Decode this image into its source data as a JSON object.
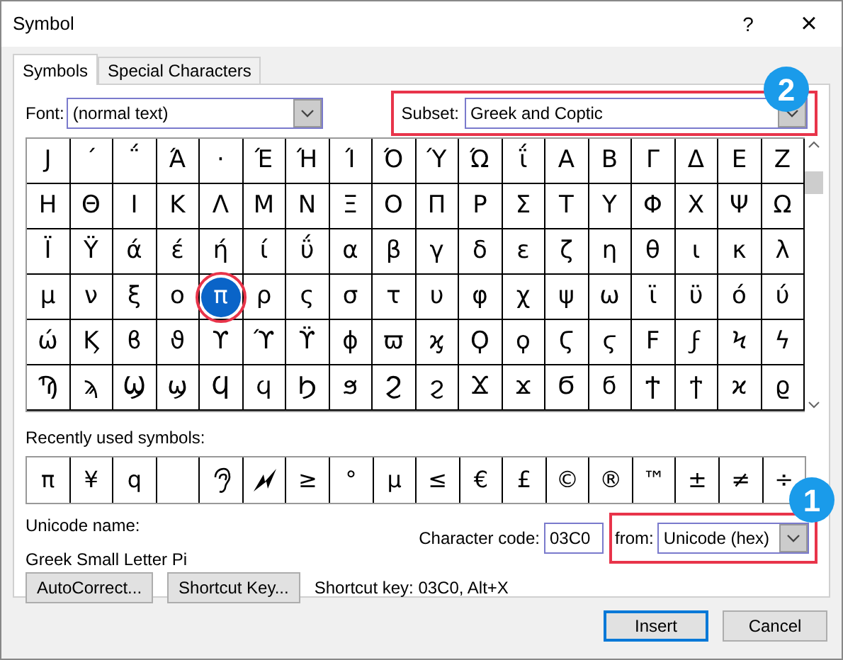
{
  "window": {
    "title": "Symbol",
    "help": "?",
    "close": "×"
  },
  "tabs": [
    {
      "label": "Symbols",
      "selected": true
    },
    {
      "label": "Special Characters",
      "selected": false
    }
  ],
  "font": {
    "label": "Font:",
    "value": "(normal text)"
  },
  "subset": {
    "label": "Subset:",
    "value": "Greek and Coptic"
  },
  "grid": [
    [
      {
        "char": "Ϳ",
        "selected": false
      },
      {
        "char": "΄",
        "selected": false
      },
      {
        "char": "΅",
        "selected": false
      },
      {
        "char": "Ά",
        "selected": false
      },
      {
        "char": "·",
        "selected": false
      },
      {
        "char": "Έ",
        "selected": false
      },
      {
        "char": "Ή",
        "selected": false
      },
      {
        "char": "Ί",
        "selected": false
      },
      {
        "char": "Ό",
        "selected": false
      },
      {
        "char": "Ύ",
        "selected": false
      },
      {
        "char": "Ώ",
        "selected": false
      },
      {
        "char": "ΐ",
        "selected": false
      },
      {
        "char": "Α",
        "selected": false
      },
      {
        "char": "Β",
        "selected": false
      },
      {
        "char": "Γ",
        "selected": false
      },
      {
        "char": "Δ",
        "selected": false
      },
      {
        "char": "Ε",
        "selected": false
      },
      {
        "char": "Ζ",
        "selected": false
      }
    ],
    [
      {
        "char": "Η",
        "selected": false
      },
      {
        "char": "Θ",
        "selected": false
      },
      {
        "char": "Ι",
        "selected": false
      },
      {
        "char": "Κ",
        "selected": false
      },
      {
        "char": "Λ",
        "selected": false
      },
      {
        "char": "Μ",
        "selected": false
      },
      {
        "char": "Ν",
        "selected": false
      },
      {
        "char": "Ξ",
        "selected": false
      },
      {
        "char": "Ο",
        "selected": false
      },
      {
        "char": "Π",
        "selected": false
      },
      {
        "char": "Ρ",
        "selected": false
      },
      {
        "char": "Σ",
        "selected": false
      },
      {
        "char": "Τ",
        "selected": false
      },
      {
        "char": "Υ",
        "selected": false
      },
      {
        "char": "Φ",
        "selected": false
      },
      {
        "char": "Χ",
        "selected": false
      },
      {
        "char": "Ψ",
        "selected": false
      },
      {
        "char": "Ω",
        "selected": false
      }
    ],
    [
      {
        "char": "Ϊ",
        "selected": false
      },
      {
        "char": "Ϋ",
        "selected": false
      },
      {
        "char": "ά",
        "selected": false
      },
      {
        "char": "έ",
        "selected": false
      },
      {
        "char": "ή",
        "selected": false
      },
      {
        "char": "ί",
        "selected": false
      },
      {
        "char": "ΰ",
        "selected": false
      },
      {
        "char": "α",
        "selected": false
      },
      {
        "char": "β",
        "selected": false
      },
      {
        "char": "γ",
        "selected": false
      },
      {
        "char": "δ",
        "selected": false
      },
      {
        "char": "ε",
        "selected": false
      },
      {
        "char": "ζ",
        "selected": false
      },
      {
        "char": "η",
        "selected": false
      },
      {
        "char": "θ",
        "selected": false
      },
      {
        "char": "ι",
        "selected": false
      },
      {
        "char": "κ",
        "selected": false
      },
      {
        "char": "λ",
        "selected": false
      }
    ],
    [
      {
        "char": "μ",
        "selected": false
      },
      {
        "char": "ν",
        "selected": false
      },
      {
        "char": "ξ",
        "selected": false
      },
      {
        "char": "ο",
        "selected": false
      },
      {
        "char": "π",
        "selected": true
      },
      {
        "char": "ρ",
        "selected": false
      },
      {
        "char": "ς",
        "selected": false
      },
      {
        "char": "σ",
        "selected": false
      },
      {
        "char": "τ",
        "selected": false
      },
      {
        "char": "υ",
        "selected": false
      },
      {
        "char": "φ",
        "selected": false
      },
      {
        "char": "χ",
        "selected": false
      },
      {
        "char": "ψ",
        "selected": false
      },
      {
        "char": "ω",
        "selected": false
      },
      {
        "char": "ϊ",
        "selected": false
      },
      {
        "char": "ϋ",
        "selected": false
      },
      {
        "char": "ό",
        "selected": false
      },
      {
        "char": "ύ",
        "selected": false
      }
    ],
    [
      {
        "char": "ώ",
        "selected": false
      },
      {
        "char": "Ϗ",
        "selected": false
      },
      {
        "char": "ϐ",
        "selected": false
      },
      {
        "char": "ϑ",
        "selected": false
      },
      {
        "char": "ϒ",
        "selected": false
      },
      {
        "char": "ϓ",
        "selected": false
      },
      {
        "char": "ϔ",
        "selected": false
      },
      {
        "char": "ϕ",
        "selected": false
      },
      {
        "char": "ϖ",
        "selected": false
      },
      {
        "char": "ϗ",
        "selected": false
      },
      {
        "char": "Ϙ",
        "selected": false
      },
      {
        "char": "ϙ",
        "selected": false
      },
      {
        "char": "Ϛ",
        "selected": false
      },
      {
        "char": "ϛ",
        "selected": false
      },
      {
        "char": "Ϝ",
        "selected": false
      },
      {
        "char": "ϝ",
        "selected": false
      },
      {
        "char": "Ϟ",
        "selected": false
      },
      {
        "char": "ϟ",
        "selected": false
      }
    ],
    [
      {
        "char": "Ϡ",
        "selected": false
      },
      {
        "char": "ϡ",
        "selected": false
      },
      {
        "char": "Ϣ",
        "selected": false
      },
      {
        "char": "ϣ",
        "selected": false
      },
      {
        "char": "Ϥ",
        "selected": false
      },
      {
        "char": "ϥ",
        "selected": false
      },
      {
        "char": "Ϧ",
        "selected": false
      },
      {
        "char": "ϧ",
        "selected": false
      },
      {
        "char": "Ϩ",
        "selected": false
      },
      {
        "char": "ϩ",
        "selected": false
      },
      {
        "char": "Ϫ",
        "selected": false
      },
      {
        "char": "ϫ",
        "selected": false
      },
      {
        "char": "Ϭ",
        "selected": false
      },
      {
        "char": "ϭ",
        "selected": false
      },
      {
        "char": "Ϯ",
        "selected": false
      },
      {
        "char": "ϯ",
        "selected": false
      },
      {
        "char": "ϰ",
        "selected": false
      },
      {
        "char": "ϱ",
        "selected": false
      }
    ]
  ],
  "recent": {
    "label": "Recently used symbols:",
    "items": [
      {
        "kind": "char",
        "char": "π"
      },
      {
        "kind": "char",
        "char": "¥"
      },
      {
        "kind": "char",
        "char": "q"
      },
      {
        "kind": "blank"
      },
      {
        "kind": "ear"
      },
      {
        "kind": "bolt"
      },
      {
        "kind": "char",
        "char": "≥"
      },
      {
        "kind": "char",
        "char": "°"
      },
      {
        "kind": "char",
        "char": "µ"
      },
      {
        "kind": "char",
        "char": "≤"
      },
      {
        "kind": "char",
        "char": "€"
      },
      {
        "kind": "char",
        "char": "£"
      },
      {
        "kind": "char",
        "char": "©"
      },
      {
        "kind": "char",
        "char": "®"
      },
      {
        "kind": "char",
        "char": "™"
      },
      {
        "kind": "char",
        "char": "±"
      },
      {
        "kind": "char",
        "char": "≠"
      },
      {
        "kind": "char",
        "char": "÷"
      }
    ]
  },
  "unicode_name": {
    "label": "Unicode name:",
    "value": "Greek Small Letter Pi"
  },
  "character_code": {
    "label": "Character code:",
    "value": "03C0"
  },
  "from": {
    "label": "from:",
    "value": "Unicode (hex)"
  },
  "buttons": [
    "AutoCorrect...",
    "Shortcut Key..."
  ],
  "shortcut_text": "Shortcut key: 03C0, Alt+X",
  "footer_buttons": [
    {
      "label": "Insert",
      "default": true
    },
    {
      "label": "Cancel",
      "default": false
    }
  ],
  "callouts": [
    {
      "number": "2"
    },
    {
      "number": "1"
    }
  ]
}
